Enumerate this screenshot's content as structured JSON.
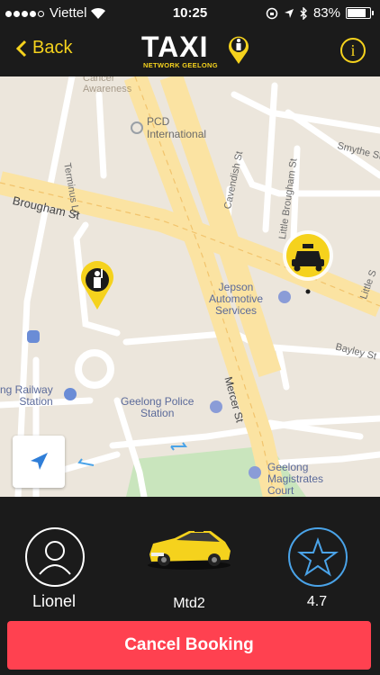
{
  "status_bar": {
    "carrier": "Viettel",
    "time": "10:25",
    "battery_percent": "83%",
    "battery_level": 0.83,
    "signal_dots_filled": 4,
    "signal_dots_total": 5
  },
  "nav": {
    "back_label": "Back",
    "logo_word": "TAXI",
    "logo_subtitle": "NETWORK GEELONG",
    "info_icon": "info-icon"
  },
  "map": {
    "labels": {
      "terminus": "Terminus Ln",
      "pcd": "PCD\nInternational",
      "smythe": "Smythe St",
      "cavendish": "Cavendish St",
      "little_brougham": "Little Brougham St",
      "brougham": "Brougham St",
      "jepson": "Jepson\nAutomotive\nServices",
      "little_s": "Little S",
      "bayley": "Bayley St",
      "railway": "ng Railway\nStation",
      "police": "Geelong Police\nStation",
      "mercer": "Mercer St",
      "magistrates": "Geelong\nMagistrates\nCourt",
      "faded_top": "Cancer\nAwareness"
    },
    "colors": {
      "background": "#ece6dc",
      "major_road": "#fbe3a2",
      "minor_road": "#ffffff",
      "park": "#c9e5bd",
      "marker_yellow": "#f5d21d"
    }
  },
  "booking": {
    "driver_name": "Lionel",
    "car_id": "Mtd2",
    "rating": "4.7",
    "cancel_label": "Cancel Booking"
  },
  "accent_color": "#f5d21d",
  "cancel_color": "#ff4150"
}
